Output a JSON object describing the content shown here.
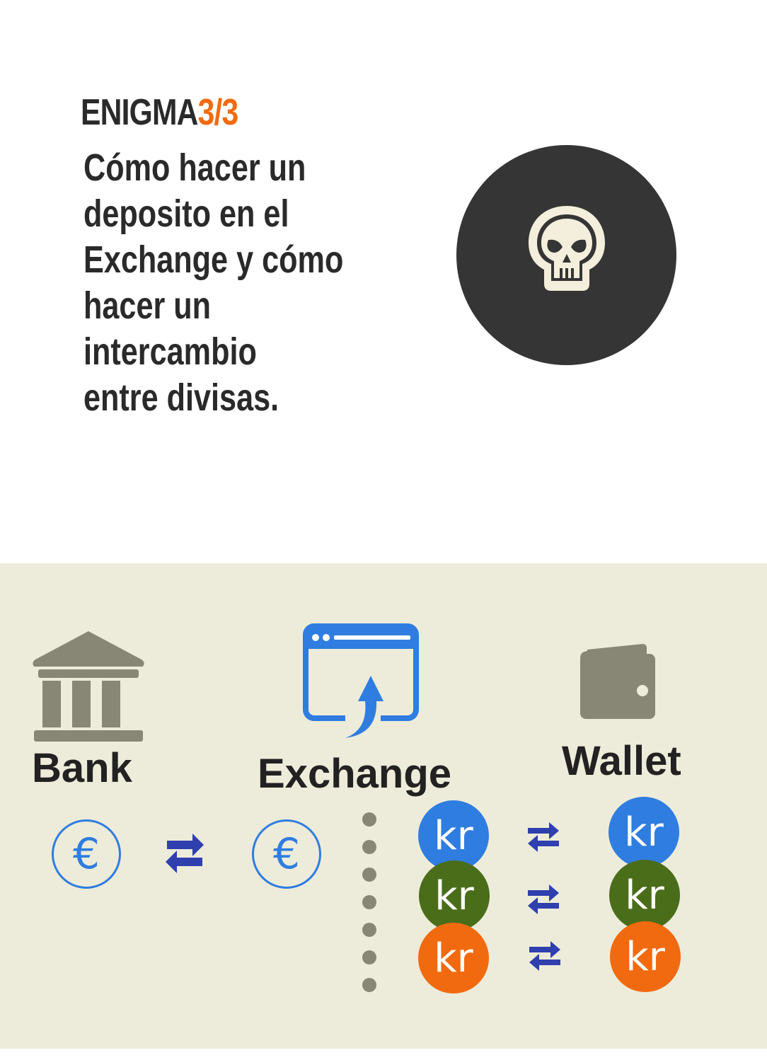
{
  "heading": {
    "prefix": "ENIGMA",
    "counter": "3/3"
  },
  "subtitle": "Cómo hacer un\ndeposito en el\nExchange y cómo\nhacer un\nintercambio\nentre divisas.",
  "icons": {
    "skull": "skull-icon",
    "bank": "bank-icon",
    "exchange": "browser-upload-icon",
    "wallet": "wallet-icon",
    "swap": "swap-arrows-icon"
  },
  "diagram": {
    "bank_label": "Bank",
    "exchange_label": "Exchange",
    "wallet_label": "Wallet",
    "euro_symbol": "€",
    "krona_symbol": "kr",
    "coin_colors": [
      "#2f7de0",
      "#4a6d1a",
      "#f26a0f"
    ]
  },
  "colors": {
    "accent": "#f26a0f",
    "panel_bg": "#edecda",
    "icon_gray": "#888675",
    "exchange_blue": "#2f7de0",
    "arrow_blue": "#2f3fae"
  }
}
